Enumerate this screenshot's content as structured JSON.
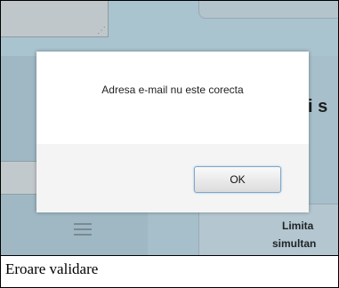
{
  "background": {
    "heading_fragment": "i s",
    "card_title_fragment": "Limita",
    "card_subtitle_fragment": "simultan"
  },
  "dialog": {
    "message": "Adresa e-mail nu este corecta",
    "ok_label": "OK"
  },
  "caption": "Eroare validare"
}
